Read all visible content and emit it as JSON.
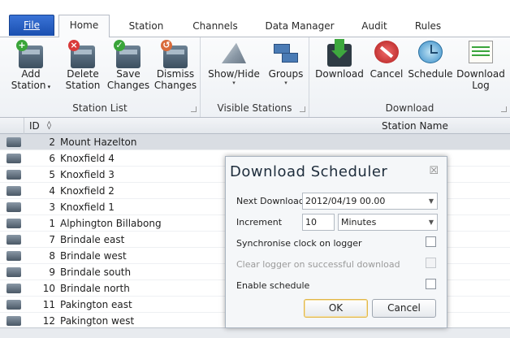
{
  "tabs": [
    {
      "label": "File"
    },
    {
      "label": "Home"
    },
    {
      "label": "Station"
    },
    {
      "label": "Channels"
    },
    {
      "label": "Data Manager"
    },
    {
      "label": "Audit"
    },
    {
      "label": "Rules"
    }
  ],
  "ribbon": {
    "station_list": {
      "label": "Station List",
      "add": [
        "Add",
        "Station"
      ],
      "delete": [
        "Delete",
        "Station"
      ],
      "save": [
        "Save",
        "Changes"
      ],
      "dismiss": [
        "Dismiss",
        "Changes"
      ]
    },
    "visible_stations": {
      "label": "Visible Stations",
      "showhide": "Show/Hide",
      "groups": "Groups"
    },
    "download": {
      "label": "Download",
      "download": "Download",
      "cancel": "Cancel",
      "schedule": "Schedule",
      "download_log": [
        "Download",
        "Log"
      ]
    }
  },
  "grid": {
    "col_id": "ID",
    "sort_glyph": "◊",
    "col_name": "Station Name",
    "rows": [
      {
        "id": "2",
        "name": "Mount Hazelton"
      },
      {
        "id": "6",
        "name": "Knoxfield 4"
      },
      {
        "id": "5",
        "name": "Knoxfield 3"
      },
      {
        "id": "4",
        "name": "Knoxfield 2"
      },
      {
        "id": "3",
        "name": "Knoxfield 1"
      },
      {
        "id": "1",
        "name": "Alphington Billabong"
      },
      {
        "id": "7",
        "name": "Brindale east"
      },
      {
        "id": "8",
        "name": "Brindale west"
      },
      {
        "id": "9",
        "name": "Brindale south"
      },
      {
        "id": "10",
        "name": "Brindale north"
      },
      {
        "id": "11",
        "name": "Pakington east"
      },
      {
        "id": "12",
        "name": "Pakington west"
      }
    ]
  },
  "dialog": {
    "title": "Download Scheduler",
    "close": "☒",
    "next_download_label": "Next Download",
    "next_download_value": "2012/04/19 00.00",
    "increment_label": "Increment",
    "increment_value": "10",
    "increment_unit": "Minutes",
    "sync_label": "Synchronise clock on logger",
    "clear_label": "Clear logger on successful download",
    "enable_label": "Enable schedule",
    "ok": "OK",
    "cancel": "Cancel"
  }
}
